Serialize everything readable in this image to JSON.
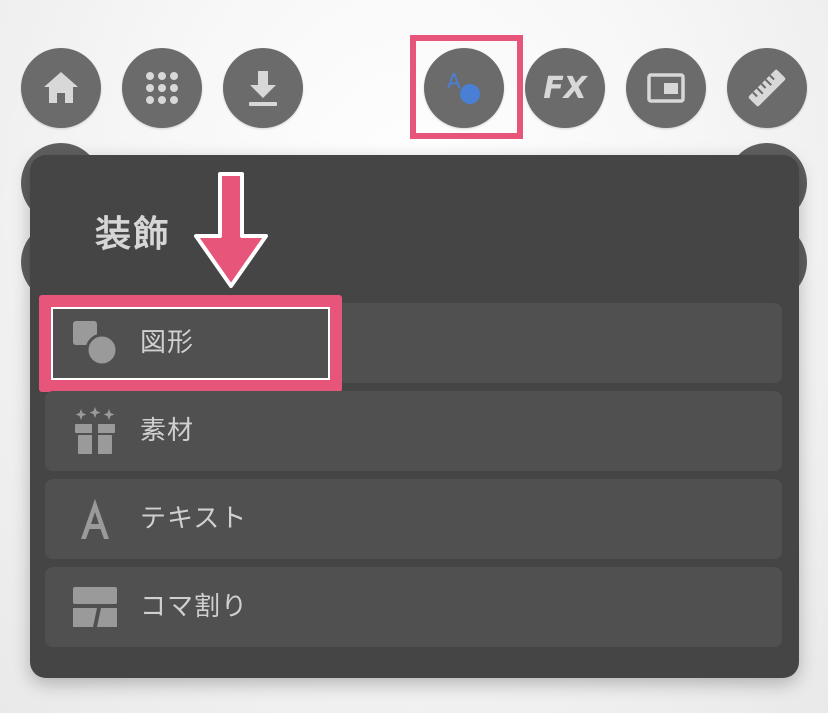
{
  "toolbar": {
    "buttons": [
      {
        "name": "home",
        "icon": "home-icon"
      },
      {
        "name": "grid",
        "icon": "grid-dots-icon"
      },
      {
        "name": "download",
        "icon": "download-icon"
      },
      {
        "name": "decoration",
        "icon": "text-shape-icon",
        "label": "A"
      },
      {
        "name": "fx",
        "icon": "fx-icon",
        "label": "FX"
      },
      {
        "name": "window",
        "icon": "window-icon"
      },
      {
        "name": "ruler",
        "icon": "ruler-icon"
      }
    ]
  },
  "panel": {
    "title": "装飾",
    "items": [
      {
        "label": "図形",
        "icon": "shapes-icon",
        "selected": true
      },
      {
        "label": "素材",
        "icon": "gift-sparkle-icon"
      },
      {
        "label": "テキスト",
        "icon": "letter-a-icon"
      },
      {
        "label": "コマ割り",
        "icon": "panel-layout-icon"
      }
    ]
  },
  "colors": {
    "accent": "#e8557a",
    "panel_bg": "#454545",
    "row_bg": "#505050",
    "button_bg": "#6b6b6b",
    "icon_fg": "#d8d8d8",
    "decoration_icon_blue": "#4a7fd6"
  }
}
